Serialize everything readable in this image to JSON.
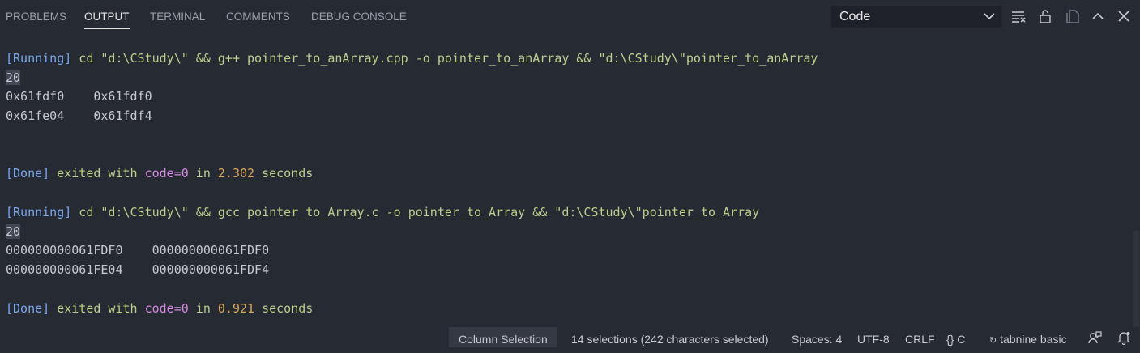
{
  "panel_tabs": [
    "PROBLEMS",
    "OUTPUT",
    "TERMINAL",
    "COMMENTS",
    "DEBUG CONSOLE"
  ],
  "output_channel": "Code",
  "output": {
    "run1": {
      "tag": "[Running]",
      "command": " cd \"d:\\CStudy\\\" && g++ pointer_to_anArray.cpp -o pointer_to_anArray && \"d:\\CStudy\\\"pointer_to_anArray",
      "size": "20",
      "rows": [
        {
          "a": "0x61fdf0",
          "b": "0x61fdf0"
        },
        {
          "a": "0x61fe04",
          "b": "0x61fdf4"
        }
      ],
      "done_tag": "[Done]",
      "exited_with": " exited with ",
      "code": "code=0",
      "in": " in ",
      "time": "2.302",
      "seconds": " seconds"
    },
    "run2": {
      "tag": "[Running]",
      "command": " cd \"d:\\CStudy\\\" && gcc pointer_to_Array.c -o pointer_to_Array && \"d:\\CStudy\\\"pointer_to_Array",
      "size": "20",
      "rows": [
        {
          "a": "000000000061FDF0",
          "b": "000000000061FDF0"
        },
        {
          "a": "000000000061FE04",
          "b": "000000000061FDF4"
        }
      ],
      "done_tag": "[Done]",
      "exited_with": " exited with ",
      "code": "code=0",
      "in": " in ",
      "time": "0.921",
      "seconds": " seconds"
    }
  },
  "status": {
    "column_selection": "Column Selection",
    "selections": "14 selections (242 characters selected)",
    "spaces": "Spaces: 4",
    "encoding": "UTF-8",
    "eol": "CRLF",
    "language_braces": "{}",
    "language": "C",
    "tabnine": "tabnine basic"
  },
  "icons": {
    "clear_output": "clear-output-icon",
    "lock": "unlock-icon",
    "open_editor": "open-in-editor-icon",
    "maximize": "chevron-up-icon",
    "close": "close-icon"
  }
}
